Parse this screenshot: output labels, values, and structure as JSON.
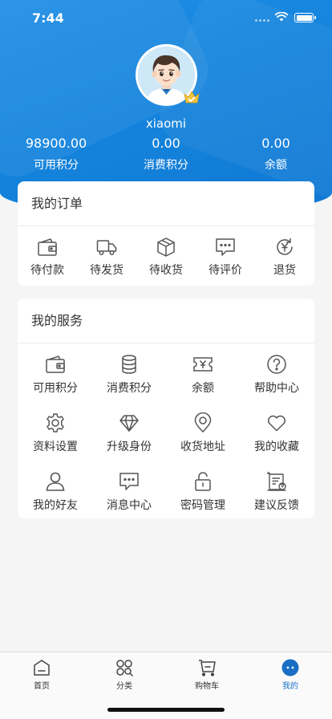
{
  "status_bar": {
    "time": "7:44"
  },
  "profile": {
    "username": "xiaomi",
    "stats": [
      {
        "value": "98900.00",
        "label": "可用积分"
      },
      {
        "value": "0.00",
        "label": "消费积分"
      },
      {
        "value": "0.00",
        "label": "余额"
      }
    ]
  },
  "orders": {
    "title": "我的订单",
    "items": [
      {
        "label": "待付款",
        "icon": "wallet-icon"
      },
      {
        "label": "待发货",
        "icon": "truck-icon"
      },
      {
        "label": "待收货",
        "icon": "box-icon"
      },
      {
        "label": "待评价",
        "icon": "comment-icon"
      },
      {
        "label": "退货",
        "icon": "refund-icon"
      }
    ]
  },
  "services": {
    "title": "我的服务",
    "items": [
      {
        "label": "可用积分",
        "icon": "wallet-icon"
      },
      {
        "label": "消费积分",
        "icon": "coins-icon"
      },
      {
        "label": "余额",
        "icon": "ticket-icon"
      },
      {
        "label": "帮助中心",
        "icon": "help-icon"
      },
      {
        "label": "资料设置",
        "icon": "gear-icon"
      },
      {
        "label": "升级身份",
        "icon": "diamond-icon"
      },
      {
        "label": "收货地址",
        "icon": "location-icon"
      },
      {
        "label": "我的收藏",
        "icon": "heart-icon"
      },
      {
        "label": "我的好友",
        "icon": "user-icon"
      },
      {
        "label": "消息中心",
        "icon": "message-icon"
      },
      {
        "label": "密码管理",
        "icon": "lock-icon"
      },
      {
        "label": "建议反馈",
        "icon": "feedback-icon"
      }
    ]
  },
  "tabbar": {
    "items": [
      {
        "label": "首页",
        "icon": "home-icon"
      },
      {
        "label": "分类",
        "icon": "category-icon"
      },
      {
        "label": "购物车",
        "icon": "cart-icon"
      },
      {
        "label": "我的",
        "icon": "profile-icon"
      }
    ],
    "active": "我的"
  },
  "colors": {
    "brand_blue": "#1584dd",
    "active_tab": "#1a73c8",
    "icon_gray": "#555555"
  }
}
